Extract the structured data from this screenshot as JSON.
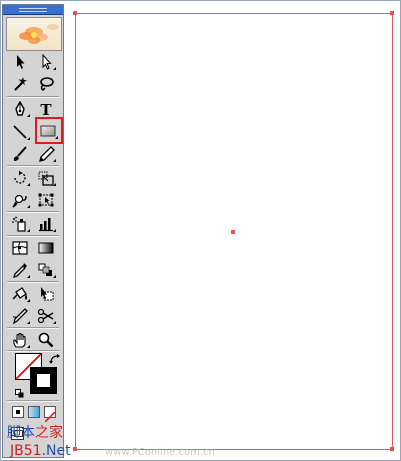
{
  "window": {
    "accent": "#3a6fd1"
  },
  "toolbox": {
    "tools": [
      {
        "name": "selection-tool-icon",
        "glyph": "arrow"
      },
      {
        "name": "direct-selection-tool-icon",
        "glyph": "arrow-white"
      },
      {
        "name": "magic-wand-tool-icon",
        "glyph": "wand"
      },
      {
        "name": "lasso-tool-icon",
        "glyph": "lasso"
      },
      {
        "name": "pen-tool-icon",
        "glyph": "pen"
      },
      {
        "name": "type-tool-icon",
        "glyph": "T"
      },
      {
        "name": "line-segment-tool-icon",
        "glyph": "line"
      },
      {
        "name": "rectangle-tool-icon",
        "glyph": "rect",
        "selected": true
      },
      {
        "name": "paintbrush-tool-icon",
        "glyph": "brush"
      },
      {
        "name": "pencil-tool-icon",
        "glyph": "pencil"
      },
      {
        "name": "rotate-tool-icon",
        "glyph": "rotate"
      },
      {
        "name": "scale-tool-icon",
        "glyph": "scale"
      },
      {
        "name": "warp-tool-icon",
        "glyph": "warp"
      },
      {
        "name": "free-transform-tool-icon",
        "glyph": "free-transform"
      },
      {
        "name": "symbol-sprayer-tool-icon",
        "glyph": "spray"
      },
      {
        "name": "column-graph-tool-icon",
        "glyph": "graph"
      },
      {
        "name": "mesh-tool-icon",
        "glyph": "mesh"
      },
      {
        "name": "gradient-tool-icon",
        "glyph": "gradient"
      },
      {
        "name": "eyedropper-tool-icon",
        "glyph": "eyedropper"
      },
      {
        "name": "blend-tool-icon",
        "glyph": "blend"
      },
      {
        "name": "live-paint-bucket-tool-icon",
        "glyph": "paint-bucket"
      },
      {
        "name": "live-paint-selection-tool-icon",
        "glyph": "paint-select"
      },
      {
        "name": "slice-tool-icon",
        "glyph": "slice"
      },
      {
        "name": "scissors-tool-icon",
        "glyph": "scissors"
      },
      {
        "name": "hand-tool-icon",
        "glyph": "hand"
      },
      {
        "name": "zoom-tool-icon",
        "glyph": "zoom"
      }
    ],
    "fill_color": "#ffffff",
    "stroke_color": "#000000",
    "selection_highlight_color": "#e2191c"
  },
  "artboard": {
    "border_color": "#e05a5a"
  },
  "watermark": {
    "logo_zh_1": "脚本",
    "logo_zh_2": "之家",
    "domain_a": "JB51",
    "domain_b": ".Net",
    "pconline": "www.PConline.com.cn"
  }
}
